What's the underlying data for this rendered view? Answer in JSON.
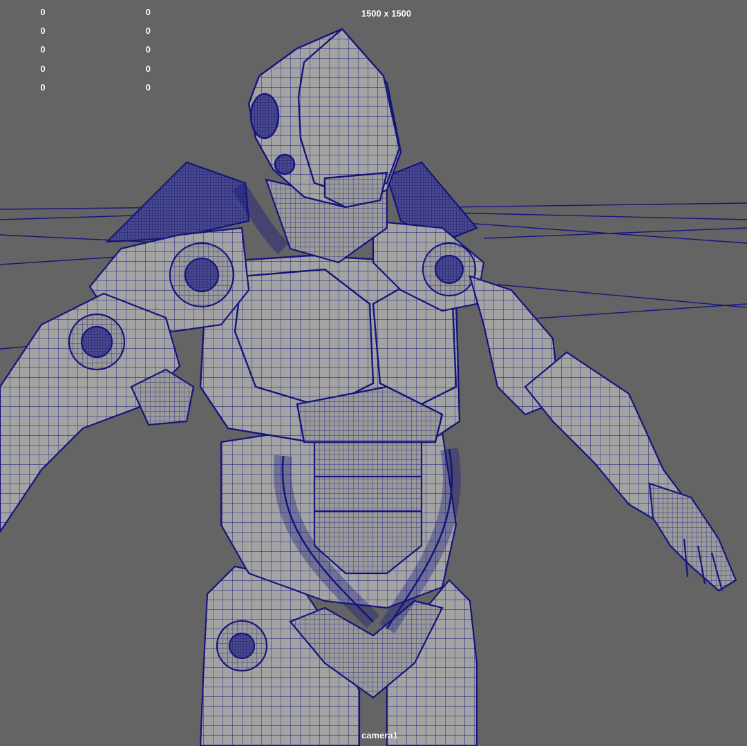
{
  "viewport": {
    "resolution_gate_label": "1500 x 1500",
    "camera_label": "camera1",
    "wireframe_color": "#14147e",
    "shaded_color": "#a7a7a7",
    "background_color": "#646464"
  },
  "hud_stats": {
    "rows": [
      {
        "col1": "0",
        "col2": "0"
      },
      {
        "col1": "0",
        "col2": "0"
      },
      {
        "col1": "0",
        "col2": "0"
      },
      {
        "col1": "0",
        "col2": "0"
      },
      {
        "col1": "0",
        "col2": "0"
      }
    ]
  },
  "scene": {
    "model": "mech-armor-robot-wireframe"
  }
}
